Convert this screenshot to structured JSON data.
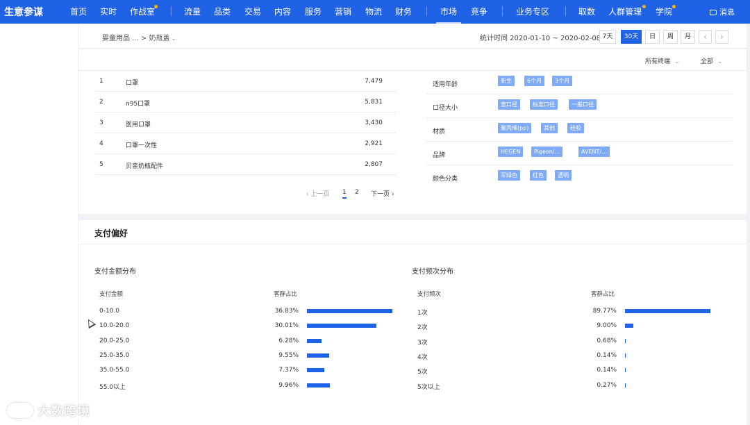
{
  "nav": {
    "brand": "生意参谋",
    "items": [
      "首页",
      "实时",
      "作战室",
      "流量",
      "品类",
      "交易",
      "内容",
      "服务",
      "营销",
      "物流",
      "财务",
      "市场",
      "竞争",
      "业务专区",
      "取数",
      "人群管理",
      "学院"
    ],
    "active": "市场",
    "message": "消息"
  },
  "header": {
    "breadcrumb_parent": "婴童用品 ...",
    "breadcrumb_sep": ">",
    "breadcrumb_current": "奶瓶盖",
    "stat_time": "统计时间 2020-01-10 ~ 2020-02-08",
    "ranges": [
      "7天",
      "30天",
      "日",
      "周",
      "月"
    ],
    "active_range": "30天",
    "prev": "‹",
    "next": "›"
  },
  "filters": {
    "terminal": "所有终端",
    "scope": "全部"
  },
  "keywords": [
    {
      "rank": "1",
      "term": "口罩",
      "value": "7,479"
    },
    {
      "rank": "2",
      "term": "n95口罩",
      "value": "5,831"
    },
    {
      "rank": "3",
      "term": "医用口罩",
      "value": "3,430"
    },
    {
      "rank": "4",
      "term": "口罩一次性",
      "value": "2,921"
    },
    {
      "rank": "5",
      "term": "贝亲奶瓶配件",
      "value": "2,807"
    }
  ],
  "pagination": {
    "prev": "‹ 上一页",
    "pages": [
      "1",
      "2"
    ],
    "next": "下一页 ›"
  },
  "attributes": [
    {
      "label": "适用年龄",
      "tags": [
        "新生",
        "6个月",
        "3个月"
      ]
    },
    {
      "label": "口径大小",
      "tags": [
        "宽口径",
        "标准口径",
        "一般口径"
      ]
    },
    {
      "label": "材质",
      "tags": [
        "聚丙烯(pp)",
        "其他",
        "硅胶"
      ]
    },
    {
      "label": "品牌",
      "tags": [
        "HEGEN",
        "Pigeon/...",
        "AVENT/..."
      ]
    },
    {
      "label": "颜色分类",
      "tags": [
        "军绿色",
        "红色",
        "透明"
      ]
    }
  ],
  "payment": {
    "title": "支付偏好",
    "amount": {
      "title": "支付金额分布",
      "col_key": "支付金额",
      "col_pct": "客群占比",
      "rows": [
        {
          "key": "0-10.0",
          "pct": "36.83%",
          "value": 36.83
        },
        {
          "key": "10.0-20.0",
          "pct": "30.01%",
          "value": 30.01
        },
        {
          "key": "20.0-25.0",
          "pct": "6.28%",
          "value": 6.28
        },
        {
          "key": "25.0-35.0",
          "pct": "9.55%",
          "value": 9.55
        },
        {
          "key": "35.0-55.0",
          "pct": "7.37%",
          "value": 7.37
        },
        {
          "key": "55.0以上",
          "pct": "9.96%",
          "value": 9.96
        }
      ]
    },
    "frequency": {
      "title": "支付频次分布",
      "col_key": "支付频次",
      "col_pct": "客群占比",
      "rows": [
        {
          "key": "1次",
          "pct": "89.77%",
          "value": 89.77
        },
        {
          "key": "2次",
          "pct": "9.00%",
          "value": 9.0
        },
        {
          "key": "3次",
          "pct": "0.68%",
          "value": 0.68
        },
        {
          "key": "4次",
          "pct": "0.14%",
          "value": 0.14
        },
        {
          "key": "5次",
          "pct": "0.14%",
          "value": 0.14
        },
        {
          "key": "5次以上",
          "pct": "0.27%",
          "value": 0.27
        }
      ]
    }
  },
  "watermark": "大数跨境",
  "colors": {
    "primary": "#2062e6",
    "tag": "#7eaaf6"
  }
}
